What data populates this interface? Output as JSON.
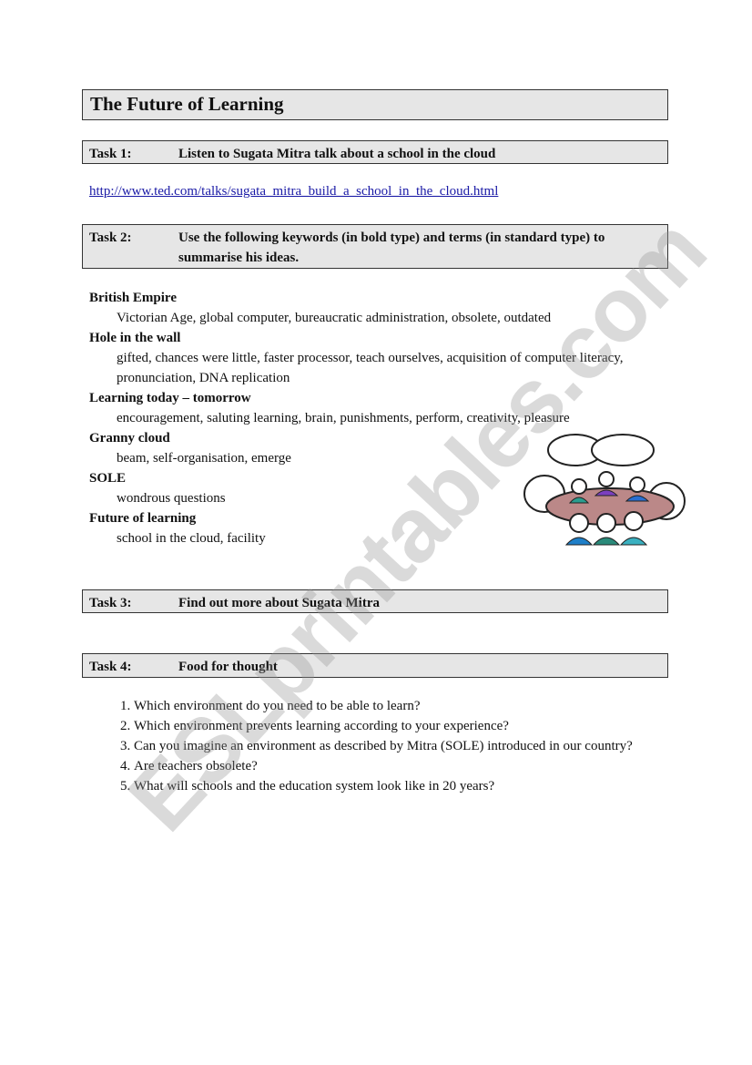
{
  "title": "The Future of Learning",
  "tasks": [
    {
      "label": "Task 1:",
      "text": "Listen to Sugata Mitra talk about a school in the cloud"
    },
    {
      "label": "Task 2:",
      "text": "Use the following keywords (in bold type) and terms (in standard type) to summarise his ideas."
    },
    {
      "label": "Task 3:",
      "text": "Find out more about Sugata Mitra"
    },
    {
      "label": "Task 4:",
      "text": "Food for thought"
    }
  ],
  "link": "http://www.ted.com/talks/sugata_mitra_build_a_school_in_the_cloud.html",
  "keywords": [
    {
      "keyword": "British Empire",
      "terms": "Victorian Age, global computer, bureaucratic administration, obsolete, outdated"
    },
    {
      "keyword": "Hole in the wall",
      "terms": "gifted, chances were little, faster processor, teach ourselves, acquisition of computer literacy, pronunciation, DNA replication"
    },
    {
      "keyword": "Learning today – tomorrow",
      "terms": "encouragement, saluting learning, brain, punishments, perform, creativity, pleasure"
    },
    {
      "keyword": "Granny cloud",
      "terms": "beam, self-organisation, emerge"
    },
    {
      "keyword": "SOLE",
      "terms": "wondrous questions"
    },
    {
      "keyword": "Future of learning",
      "terms": "school in the cloud, facility"
    }
  ],
  "questions": [
    "Which environment do you need to be able to learn?",
    "Which environment prevents learning according to your experience?",
    "Can you imagine an environment as described by Mitra (SOLE) introduced in our country?",
    "Are teachers obsolete?",
    "What will schools and the education system look like in 20 years?"
  ],
  "watermark": "ESLprintables.com",
  "colors": {
    "box_bg": "#e6e6e6",
    "link": "#1a1aa6"
  }
}
